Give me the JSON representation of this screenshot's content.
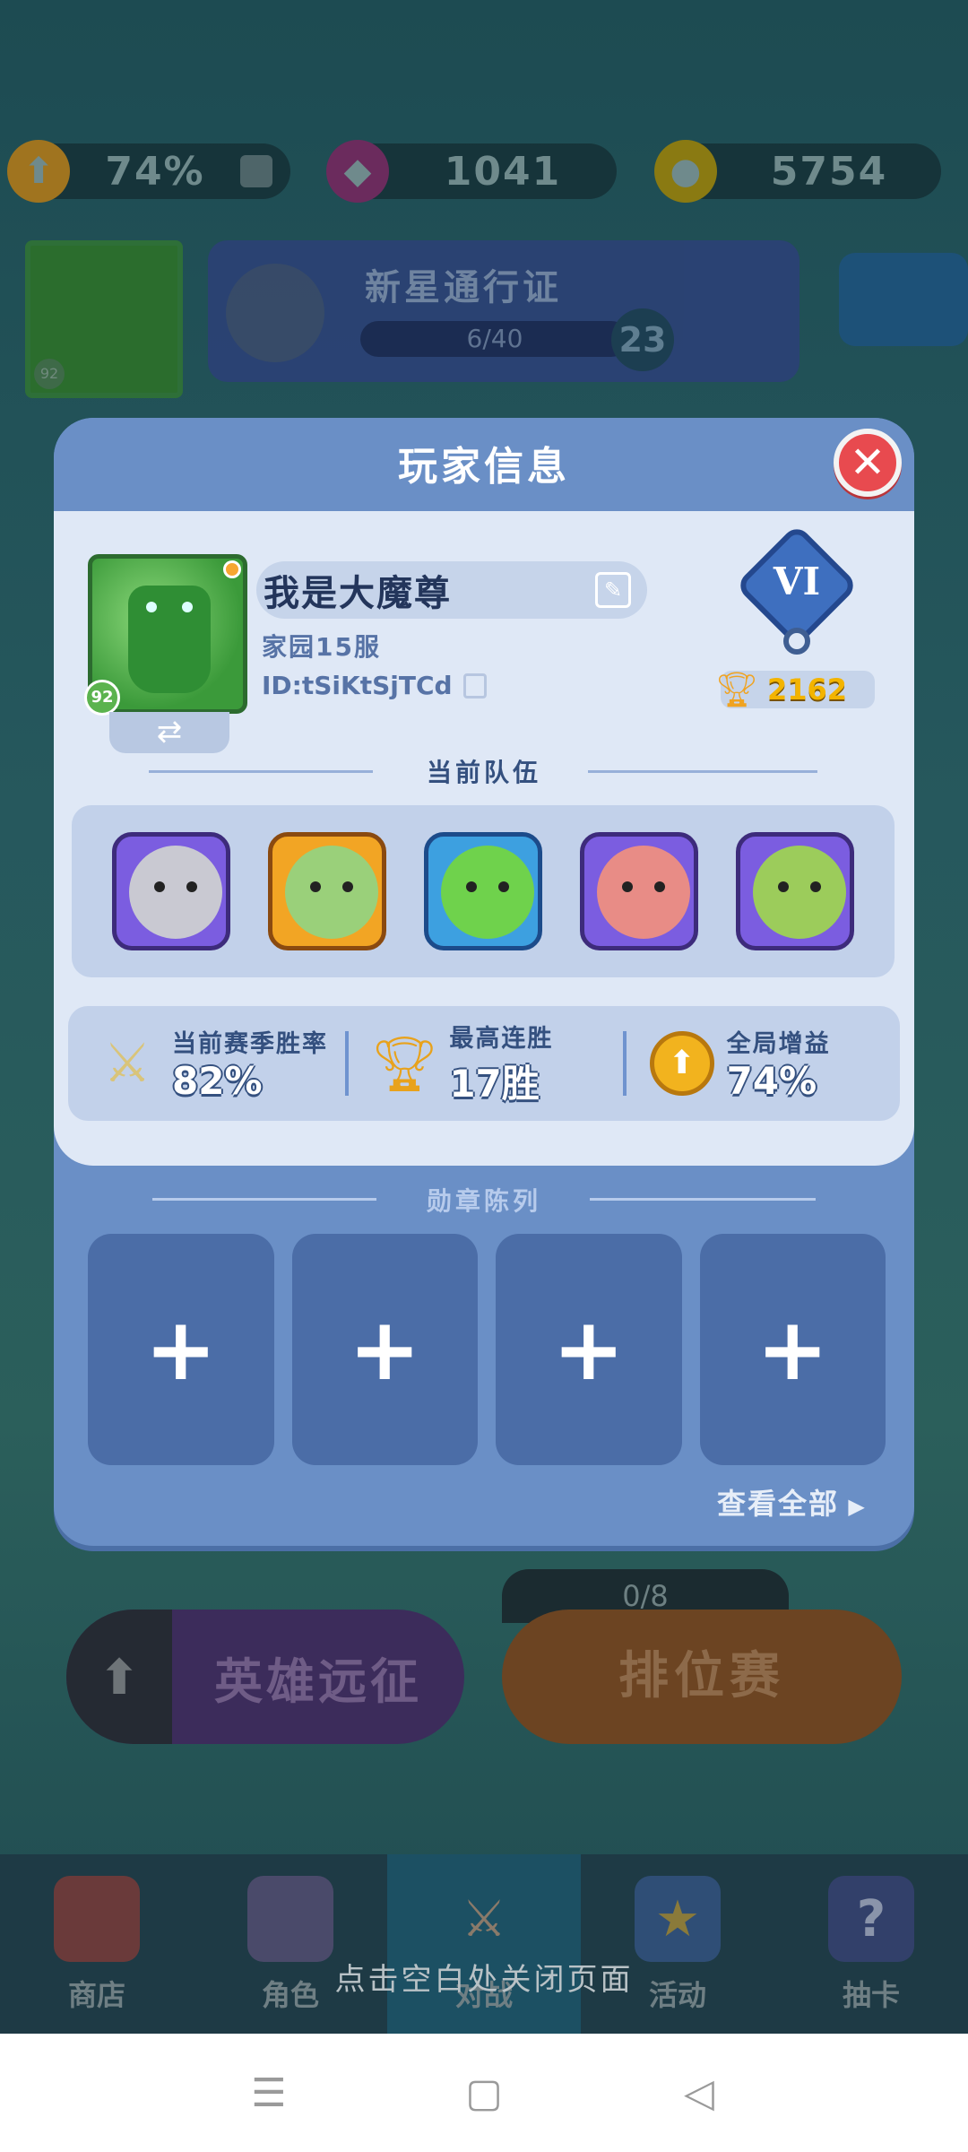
{
  "top_bar": {
    "boost_value": "74%",
    "gems": "1041",
    "coins": "5754"
  },
  "pass": {
    "title": "新星通行证",
    "progress": "6/40",
    "level": "23"
  },
  "background_avatar_level": "92",
  "modes": {
    "left": "英雄远征",
    "right": "排位赛",
    "ticket": "0/8"
  },
  "bottom_nav": {
    "tabs": [
      "商店",
      "角色",
      "对战",
      "活动",
      "抽卡"
    ]
  },
  "close_hint": "点击空白处关闭页面",
  "modal": {
    "title": "玩家信息",
    "close_label": "✕",
    "player": {
      "name": "我是大魔尊",
      "server": "家园15服",
      "id": "ID:tSiKtSjTCd",
      "level": "92",
      "rank": "VI",
      "trophies": "2162"
    },
    "team_title": "当前队伍",
    "team": [
      {
        "name": "knight",
        "bg": "#7b5de0",
        "face": "#c9c9d2"
      },
      {
        "name": "king",
        "bg": "#f2a524",
        "face": "#9ad07a"
      },
      {
        "name": "tree-warrior",
        "bg": "#3da0e0",
        "face": "#6fd24c"
      },
      {
        "name": "ogre",
        "bg": "#7b5de0",
        "face": "#e88c86"
      },
      {
        "name": "goblin-engineer",
        "bg": "#7b5de0",
        "face": "#9ccc5b"
      }
    ],
    "stats": [
      {
        "label": "当前赛季胜率",
        "value": "82%",
        "icon": "swords-icon"
      },
      {
        "label": "最高连胜",
        "value": "17胜",
        "icon": "trophy-icon"
      },
      {
        "label": "全局增益",
        "value": "74%",
        "icon": "boost-icon"
      }
    ],
    "medals_title": "勋章陈列",
    "medal_slots": [
      "+",
      "+",
      "+",
      "+"
    ],
    "view_all": "查看全部"
  }
}
